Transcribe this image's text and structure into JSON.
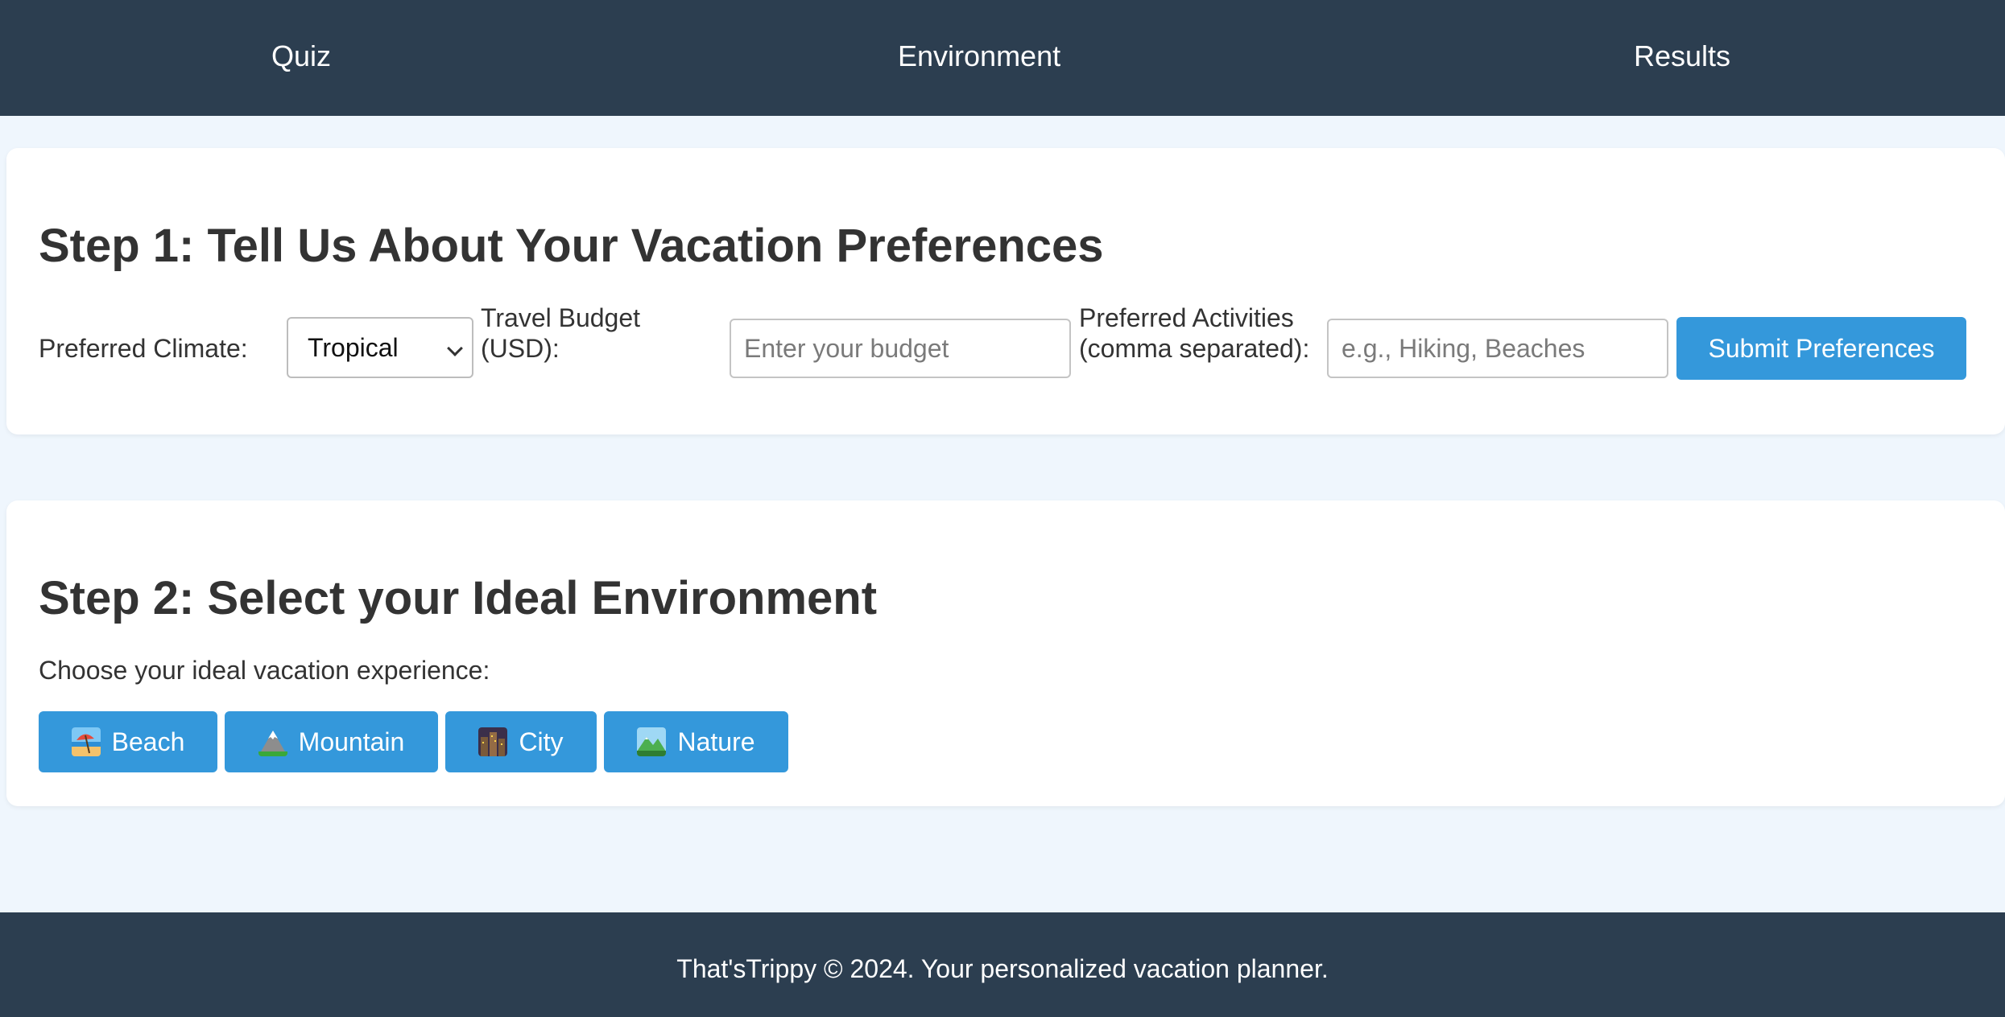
{
  "nav": {
    "items": [
      {
        "label": "Quiz"
      },
      {
        "label": "Environment"
      },
      {
        "label": "Results"
      }
    ]
  },
  "step1": {
    "title": "Step 1: Tell Us About Your Vacation Preferences",
    "climate_label": "Preferred Climate:",
    "climate_value": "Tropical",
    "budget_label_line1": "Travel Budget",
    "budget_label_line2": "(USD):",
    "budget_placeholder": "Enter your budget",
    "activities_label_line1": "Preferred Activities",
    "activities_label_line2": "(comma separated):",
    "activities_placeholder": "e.g., Hiking, Beaches",
    "submit_label": "Submit Preferences"
  },
  "step2": {
    "title": "Step 2: Select your Ideal Environment",
    "prompt": "Choose your ideal vacation experience:",
    "options": [
      {
        "label": "Beach",
        "icon": "beach-with-umbrella-icon"
      },
      {
        "label": "Mountain",
        "icon": "snow-capped-mountain-icon"
      },
      {
        "label": "City",
        "icon": "cityscape-icon"
      },
      {
        "label": "Nature",
        "icon": "national-park-icon"
      }
    ]
  },
  "footer": {
    "text": "That'sTrippy © 2024. Your personalized vacation planner."
  },
  "colors": {
    "nav_bg": "#2c3e50",
    "page_bg": "#eff6fd",
    "accent": "#3498db",
    "text": "#333333"
  }
}
